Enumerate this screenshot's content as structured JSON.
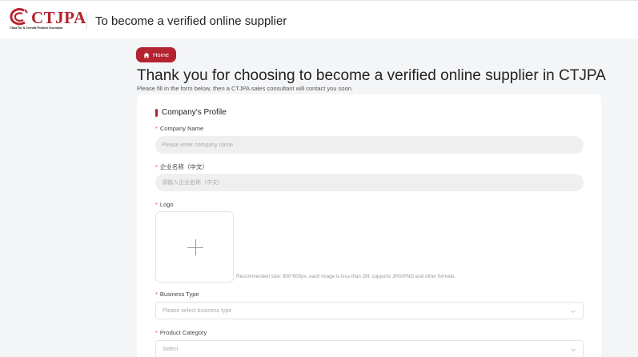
{
  "header": {
    "logo_text": "CTJPA",
    "logo_subtext": "China Toy & Juvenile Products Association",
    "title": "To become a verified online supplier"
  },
  "nav": {
    "home_label": "Home"
  },
  "page": {
    "title": "Thank you for choosing to become a verified online supplier in CTJPA",
    "subtitle": "Please fill in the form below, then a CTJPA sales consultant will contact you soon."
  },
  "form": {
    "section_title": "Company's Profile",
    "required_mark": "*",
    "company_name": {
      "label": "Company Name",
      "placeholder": "Please enter company name"
    },
    "company_name_cn": {
      "label": "企业名称（中文）",
      "placeholder": "请输入企业名称（中文）"
    },
    "logo": {
      "label": "Logo",
      "hint": "Recommended size: 800*800px, each image is less than 2M, supports JPG/PNG and other formats."
    },
    "business_type": {
      "label": "Business Type",
      "placeholder": "Please select business type"
    },
    "product_category": {
      "label": "Product Category",
      "placeholder": "Select"
    }
  },
  "colors": {
    "brand": "#b4232f",
    "required": "#d9534f",
    "background": "#f4f5f7"
  },
  "icons": [
    "home-icon",
    "plus-icon",
    "chevron-down-icon"
  ]
}
